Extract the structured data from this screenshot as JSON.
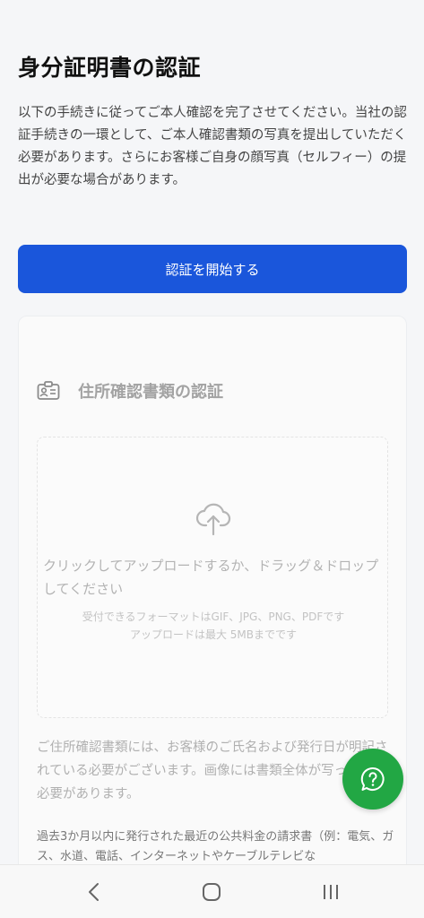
{
  "header": {
    "title": "身分証明書の認証",
    "description": "以下の手続きに従ってご本人確認を完了させてください。当社の認証手続きの一環として、ご本人確認書類の写真を提出していただく必要があります。さらにお客様ご自身の顔写真（セルフィー）の提出が必要な場合があります。"
  },
  "start_button": {
    "label": "認証を開始する"
  },
  "address_card": {
    "title": "住所確認書類の認証",
    "upload": {
      "instruction": "クリックしてアップロードするか、ドラッグ＆ドロップしてください",
      "formats": "受付できるフォーマットはGIF、JPG、PNG、PDFです",
      "max_size": "アップロードは最大 5MBまでです"
    },
    "notice": "ご住所確認書類には、お客様のご氏名および発行日が明記されている必要がございます。画像には書類全体が写っている必要があります。",
    "list_item": "過去3か月以内に発行された最近の公共料金の請求書（例：電気、ガス、水道、電話、インターネットやケーブルテレビな"
  },
  "help": {
    "icon": "question-chat-icon"
  },
  "colors": {
    "primary": "#1a56db",
    "help": "#22a744"
  }
}
